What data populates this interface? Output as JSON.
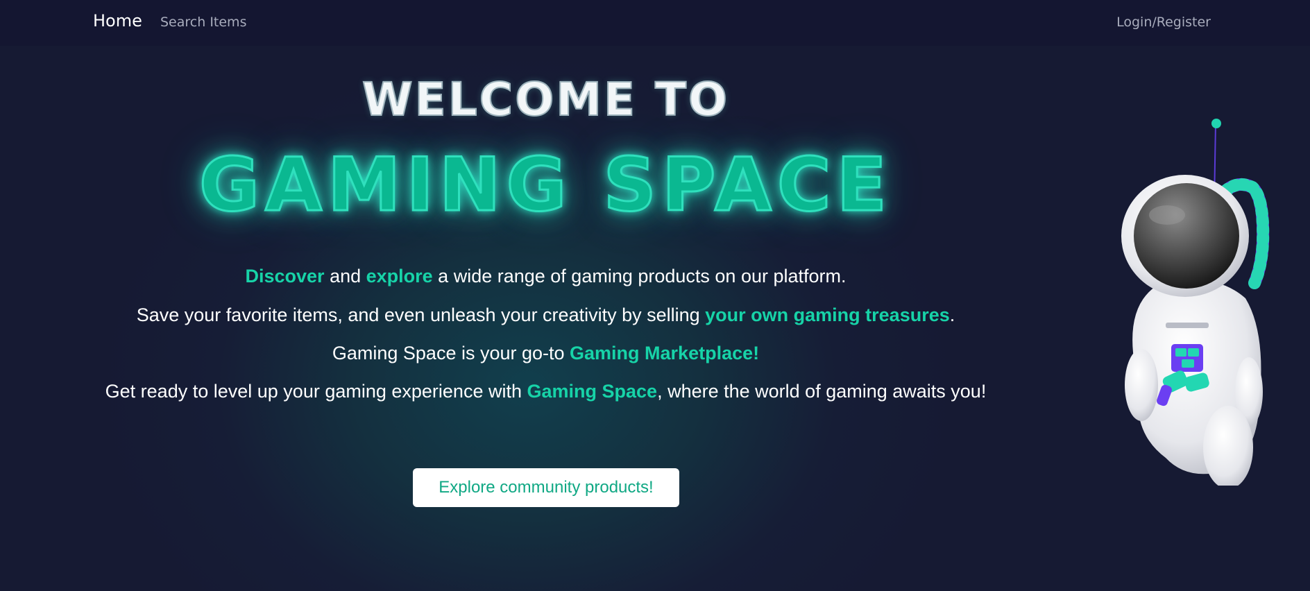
{
  "nav": {
    "home_label": "Home",
    "search_label": "Search Items",
    "login_label": "Login/Register"
  },
  "hero": {
    "welcome": "WELCOME TO",
    "title": "GAMING SPACE",
    "lines": [
      {
        "parts": [
          "Discover",
          " and ",
          "explore",
          " a wide range of gaming products on our platform."
        ]
      },
      {
        "parts": [
          "Save your favorite items, and even unleash your creativity by selling ",
          "your own gaming treasures",
          "."
        ]
      },
      {
        "parts": [
          "Gaming Space is your go-to ",
          "Gaming Marketplace!"
        ]
      },
      {
        "parts": [
          "Get ready to level up your gaming experience with ",
          "Gaming Space",
          ", where the world of gaming awaits you!"
        ]
      }
    ],
    "cta_label": "Explore community products!",
    "accent_color": "#17d3a8",
    "astronaut_illustration": "astronaut-illustration"
  }
}
